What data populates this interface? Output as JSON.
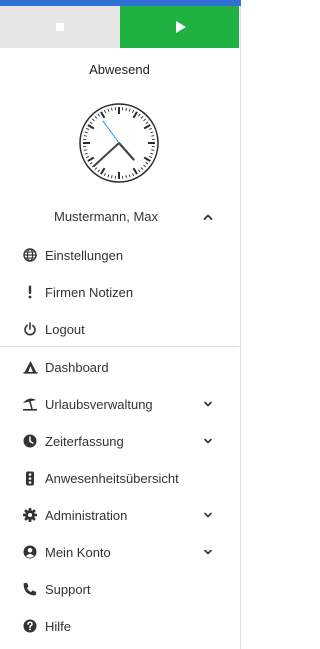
{
  "controls": {
    "stop_icon": "stop-icon",
    "play_icon": "play-icon",
    "stop_color": "#e6e6e6",
    "play_color": "#1fb141"
  },
  "status": {
    "label": "Abwesend"
  },
  "clock": {
    "hours": 4,
    "minutes": 37,
    "seconds": 54
  },
  "user": {
    "name": "Mustermann, Max",
    "expanded": true
  },
  "user_menu": [
    {
      "label": "Einstellungen",
      "icon": "globe-icon"
    },
    {
      "label": "Firmen Notizen",
      "icon": "exclamation-icon"
    },
    {
      "label": "Logout",
      "icon": "power-icon"
    }
  ],
  "main_menu": [
    {
      "label": "Dashboard",
      "icon": "campfire-icon",
      "has_submenu": false
    },
    {
      "label": "Urlaubsverwaltung",
      "icon": "umbrella-beach-icon",
      "has_submenu": true
    },
    {
      "label": "Zeiterfassung",
      "icon": "clock-icon",
      "has_submenu": true
    },
    {
      "label": "Anwesenheitsübersicht",
      "icon": "traffic-light-icon",
      "has_submenu": false
    },
    {
      "label": "Administration",
      "icon": "gear-icon",
      "has_submenu": true
    },
    {
      "label": "Mein Konto",
      "icon": "user-circle-icon",
      "has_submenu": true
    },
    {
      "label": "Support",
      "icon": "phone-icon",
      "has_submenu": false
    },
    {
      "label": "Hilfe",
      "icon": "question-circle-icon",
      "has_submenu": false
    }
  ]
}
